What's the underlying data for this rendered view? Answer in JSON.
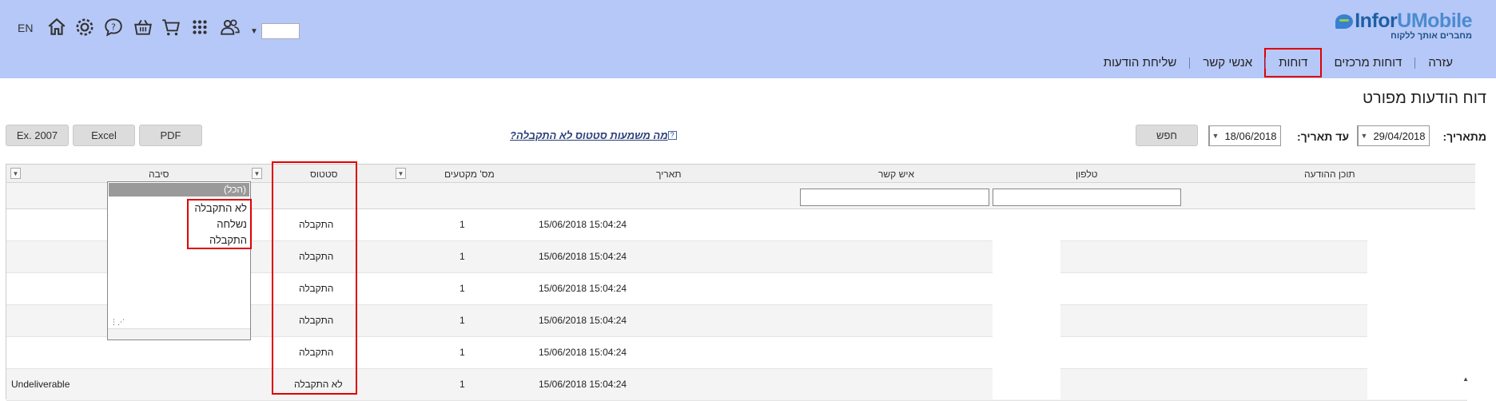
{
  "header": {
    "lang": "EN",
    "icons": [
      "home-icon",
      "settings-icon",
      "help-icon",
      "basket-icon",
      "cart-icon",
      "apps-icon",
      "contacts-icon"
    ],
    "user_value": ""
  },
  "logo": {
    "brand_1": "Infor",
    "brand_2": "UMobile",
    "tagline": "מחברים אותך ללקוח"
  },
  "nav": {
    "items": [
      {
        "label": "שליחת הודעות"
      },
      {
        "label": "אנשי קשר"
      },
      {
        "label": "דוחות"
      },
      {
        "label": "דוחות מרכזים"
      },
      {
        "label": "עזרה"
      }
    ],
    "active_index": 2
  },
  "page": {
    "title": "דוח הודעות מפורט"
  },
  "filters": {
    "from_label": "מתאריך:",
    "from_value": "29/04/2018",
    "to_label": "עד תאריך:",
    "to_value": "18/06/2018",
    "search_label": "חפש",
    "help_text": "מה משמעות סטטוס לא התקבלה?",
    "help_q": "?",
    "export_pdf": "PDF",
    "export_excel": "Excel",
    "export_ex2007": "Ex. 2007"
  },
  "grid": {
    "columns": {
      "message": "תוכן ההודעה",
      "phone": "טלפון",
      "contact": "איש קשר",
      "date": "תאריך",
      "segments": "מס' מקטעים",
      "status": "סטטוס",
      "reason": "סיבה"
    },
    "rows": [
      {
        "date": "15/06/2018 15:04:24",
        "segments": "1",
        "status": "התקבלה",
        "reason": ""
      },
      {
        "date": "15/06/2018 15:04:24",
        "segments": "1",
        "status": "התקבלה",
        "reason": ""
      },
      {
        "date": "15/06/2018 15:04:24",
        "segments": "1",
        "status": "התקבלה",
        "reason": ""
      },
      {
        "date": "15/06/2018 15:04:24",
        "segments": "1",
        "status": "התקבלה",
        "reason": ""
      },
      {
        "date": "15/06/2018 15:04:24",
        "segments": "1",
        "status": "התקבלה",
        "reason": ""
      },
      {
        "date": "15/06/2018 15:04:24",
        "segments": "1",
        "status": "לא התקבלה",
        "reason": "Undeliverable"
      }
    ]
  },
  "status_filter_popup": {
    "selected": "(הכל)",
    "options": [
      "לא התקבלה",
      "נשלחה",
      "התקבלה"
    ]
  },
  "colors": {
    "header_bg": "#b6c8f7",
    "highlight": "#e00000",
    "link": "#2b3f7a"
  }
}
